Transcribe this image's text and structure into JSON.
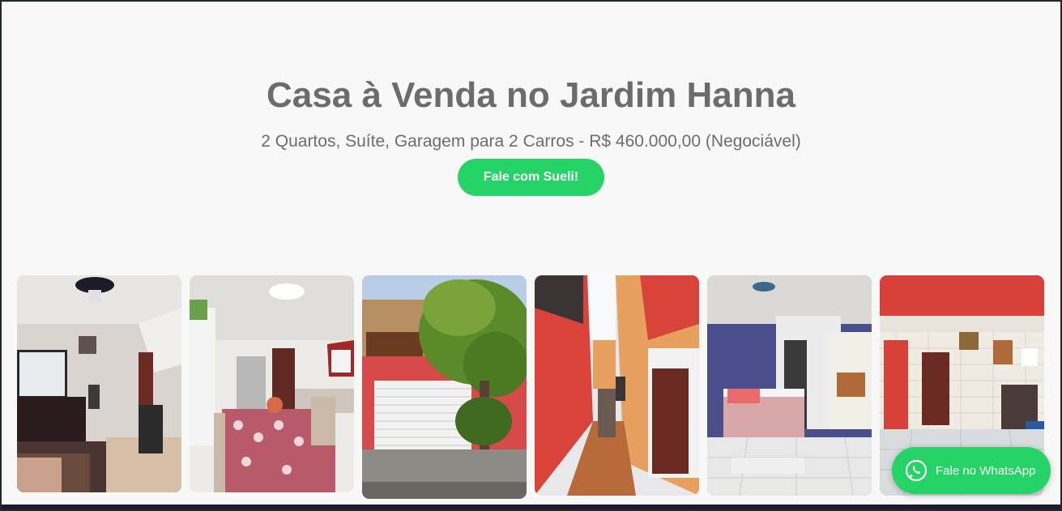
{
  "hero": {
    "title": "Casa à Venda no Jardim Hanna",
    "subtitle": "2 Quartos, Suíte, Garagem para 2 Carros - R$ 460.000,00 (Negociável)",
    "cta_label": "Fale com Sueli!"
  },
  "floating": {
    "whatsapp_label": "Fale no WhatsApp",
    "icon": "whatsapp-icon"
  },
  "gallery": {
    "photos": [
      "living-room",
      "kitchen",
      "facade",
      "side-corridor",
      "bedroom",
      "laundry-area"
    ]
  },
  "colors": {
    "accent": "#25d366",
    "text": "#6c6c6c",
    "background": "#f8f8f8"
  }
}
